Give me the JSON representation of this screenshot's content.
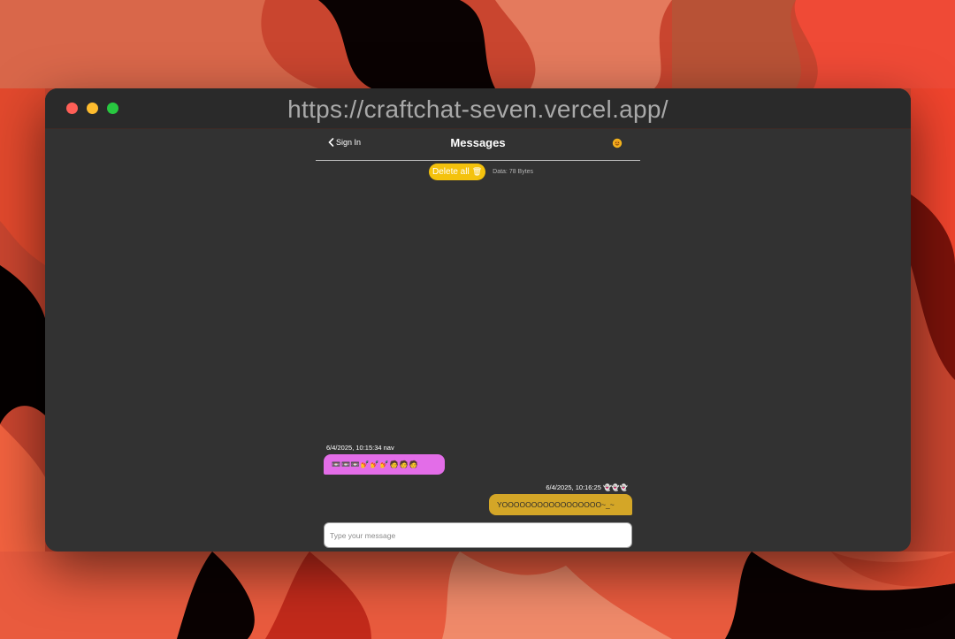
{
  "browser": {
    "url": "https://craftchat-seven.vercel.app/"
  },
  "header": {
    "back_label": "Sign In",
    "title": "Messages",
    "settings_icon": "sun-emoji-icon"
  },
  "toolbar": {
    "delete_all_label": "Delete all",
    "delete_icon": "trash-icon",
    "data_size": "Data: 78 Bytes"
  },
  "messages": [
    {
      "meta": "6/4/2025, 10:15:34 nav",
      "text": "📼📼📼💅💅💅🧑🧑🧑",
      "side": "left",
      "color": "#e36de8"
    },
    {
      "meta": "6/4/2025, 10:16:25 👻👻👻",
      "text": "YOOOOOOOOOOOOOOOOO~_~",
      "side": "right",
      "color": "#d4a627"
    }
  ],
  "composer": {
    "placeholder": "Type your message"
  },
  "colors": {
    "accent_yellow": "#f4c20d",
    "window_bg": "#323232",
    "close": "#ff5f57",
    "minimize": "#febc2e",
    "maximize": "#28c840"
  }
}
